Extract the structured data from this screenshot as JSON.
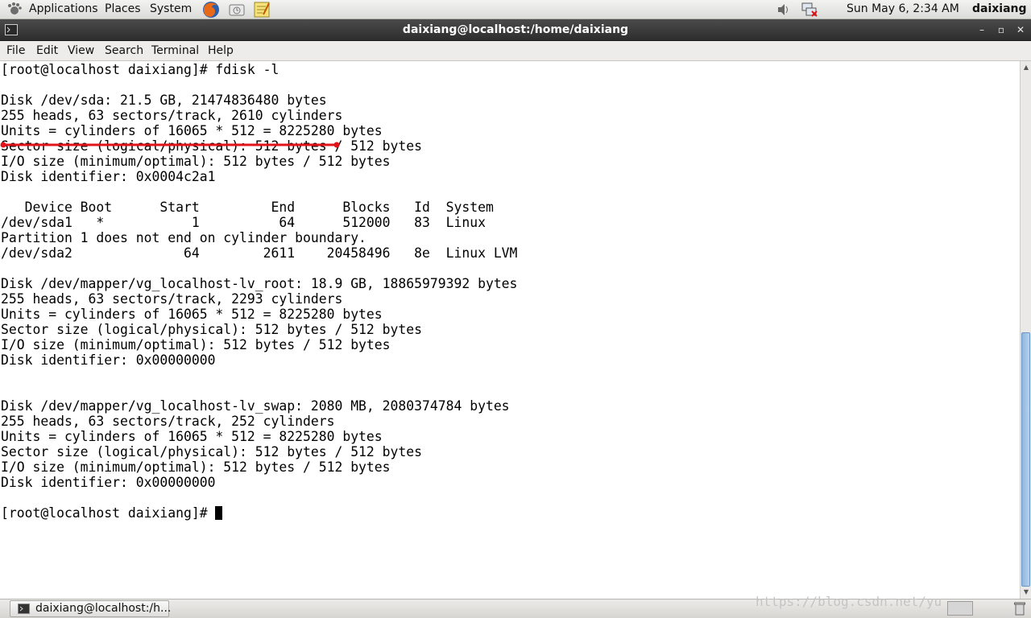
{
  "top_panel": {
    "menus": [
      "Applications",
      "Places",
      "System"
    ],
    "clock": "Sun May  6,  2:34 AM",
    "user": "daixiang"
  },
  "window": {
    "title": "daixiang@localhost:/home/daixiang"
  },
  "menubar": {
    "items": [
      "File",
      "Edit",
      "View",
      "Search",
      "Terminal",
      "Help"
    ]
  },
  "terminal": {
    "lines": [
      "[root@localhost daixiang]# fdisk -l",
      "",
      "Disk /dev/sda: 21.5 GB, 21474836480 bytes",
      "255 heads, 63 sectors/track, 2610 cylinders",
      "Units = cylinders of 16065 * 512 = 8225280 bytes",
      "Sector size (logical/physical): 512 bytes / 512 bytes",
      "I/O size (minimum/optimal): 512 bytes / 512 bytes",
      "Disk identifier: 0x0004c2a1",
      "",
      "   Device Boot      Start         End      Blocks   Id  System",
      "/dev/sda1   *           1          64      512000   83  Linux",
      "Partition 1 does not end on cylinder boundary.",
      "/dev/sda2              64        2611    20458496   8e  Linux LVM",
      "",
      "Disk /dev/mapper/vg_localhost-lv_root: 18.9 GB, 18865979392 bytes",
      "255 heads, 63 sectors/track, 2293 cylinders",
      "Units = cylinders of 16065 * 512 = 8225280 bytes",
      "Sector size (logical/physical): 512 bytes / 512 bytes",
      "I/O size (minimum/optimal): 512 bytes / 512 bytes",
      "Disk identifier: 0x00000000",
      "",
      "",
      "Disk /dev/mapper/vg_localhost-lv_swap: 2080 MB, 2080374784 bytes",
      "255 heads, 63 sectors/track, 252 cylinders",
      "Units = cylinders of 16065 * 512 = 8225280 bytes",
      "Sector size (logical/physical): 512 bytes / 512 bytes",
      "I/O size (minimum/optimal): 512 bytes / 512 bytes",
      "Disk identifier: 0x00000000",
      ""
    ],
    "prompt": "[root@localhost daixiang]# "
  },
  "taskbar": {
    "task_label": "daixiang@localhost:/h..."
  },
  "watermark": "https://blog.csdn.net/yu",
  "colors": {
    "annotation": "#e0141a",
    "titlebar": "#3a3a3a",
    "scroll_thumb": "#a7c6e8"
  }
}
